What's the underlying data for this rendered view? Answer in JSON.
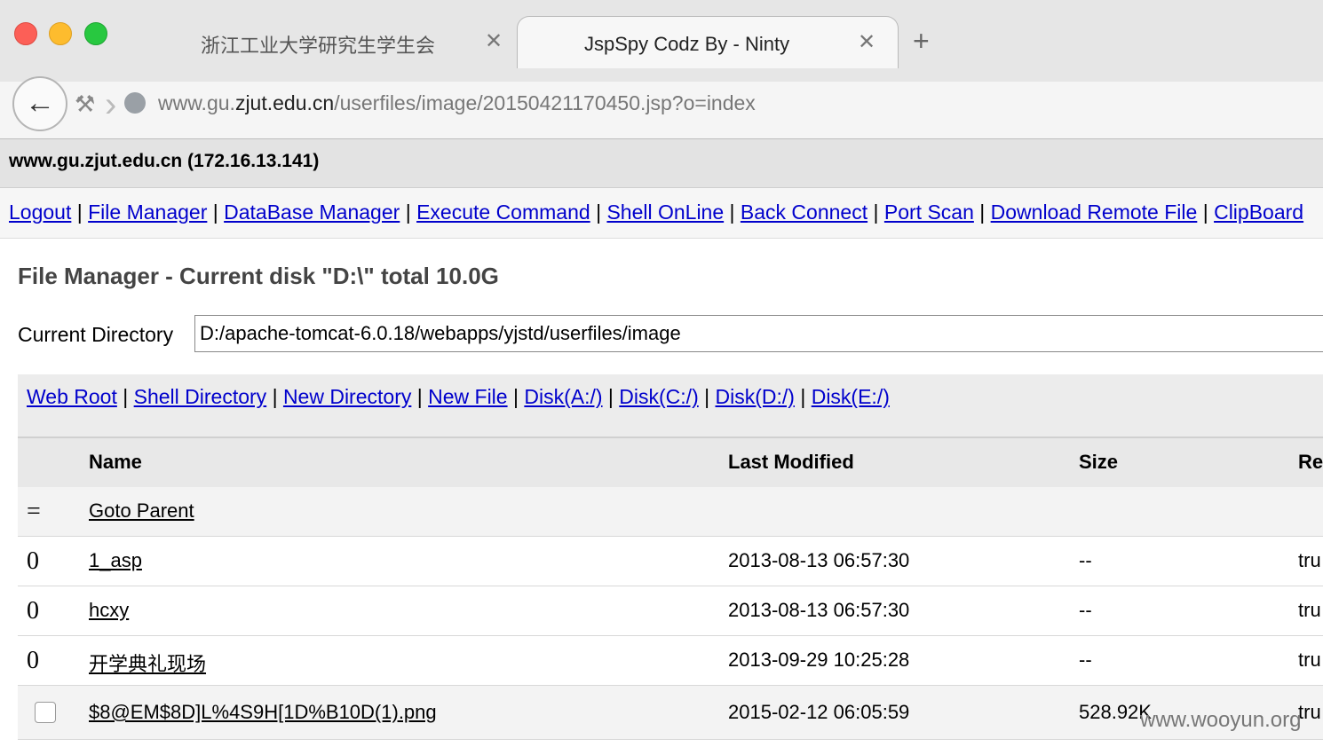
{
  "browser": {
    "tabs": [
      {
        "label": "浙江工业大学研究生学生会",
        "close": "✕",
        "active": false
      },
      {
        "label": "JspSpy Codz By - Ninty",
        "close": "✕",
        "active": true
      }
    ],
    "new_tab": "+",
    "back_icon": "arrow-left-icon",
    "url_prefix": "www.gu.",
    "url_host": "zjut.edu.cn",
    "url_path": "/userfiles/image/20150421170450.jsp?o=index"
  },
  "page": {
    "host_title": "www.gu.zjut.edu.cn (172.16.13.141)",
    "nav": [
      "Logout",
      "File Manager",
      "DataBase Manager",
      "Execute Command",
      "Shell OnLine",
      "Back Connect",
      "Port Scan",
      "Download Remote File",
      "ClipBoard"
    ],
    "fm_title": "File Manager - Current disk \"D:\\\" total 10.0G",
    "current_dir_label": "Current Directory",
    "current_dir_value": "D:/apache-tomcat-6.0.18/webapps/yjstd/userfiles/image",
    "dir_links": [
      "Web Root",
      "Shell Directory",
      "New Directory",
      "New File",
      "Disk(A:/)",
      "Disk(C:/)",
      "Disk(D:/)",
      "Disk(E:/)"
    ],
    "table": {
      "headers": {
        "name": "Name",
        "modified": "Last Modified",
        "size": "Size",
        "re": "Re"
      },
      "parent": {
        "marker": "=",
        "name": "Goto Parent"
      },
      "rows": [
        {
          "marker": "0",
          "name": "1_asp",
          "modified": "2013-08-13 06:57:30",
          "size": "--",
          "re": "tru"
        },
        {
          "marker": "0",
          "name": "hcxy",
          "modified": "2013-08-13 06:57:30",
          "size": "--",
          "re": "tru"
        },
        {
          "marker": "0",
          "name": "开学典礼现场",
          "modified": "2013-09-29 10:25:28",
          "size": "--",
          "re": "tru"
        },
        {
          "marker": "checkbox",
          "name": "$8@EM$8D]L%4S9H[1D%B10D(1).png",
          "modified": "2015-02-12 06:05:59",
          "size": "528.92K",
          "re": "tru"
        }
      ]
    },
    "watermark": "www.wooyun.org"
  },
  "colors": {
    "link": "#0000cc",
    "header_bg": "#e3e3e3"
  }
}
